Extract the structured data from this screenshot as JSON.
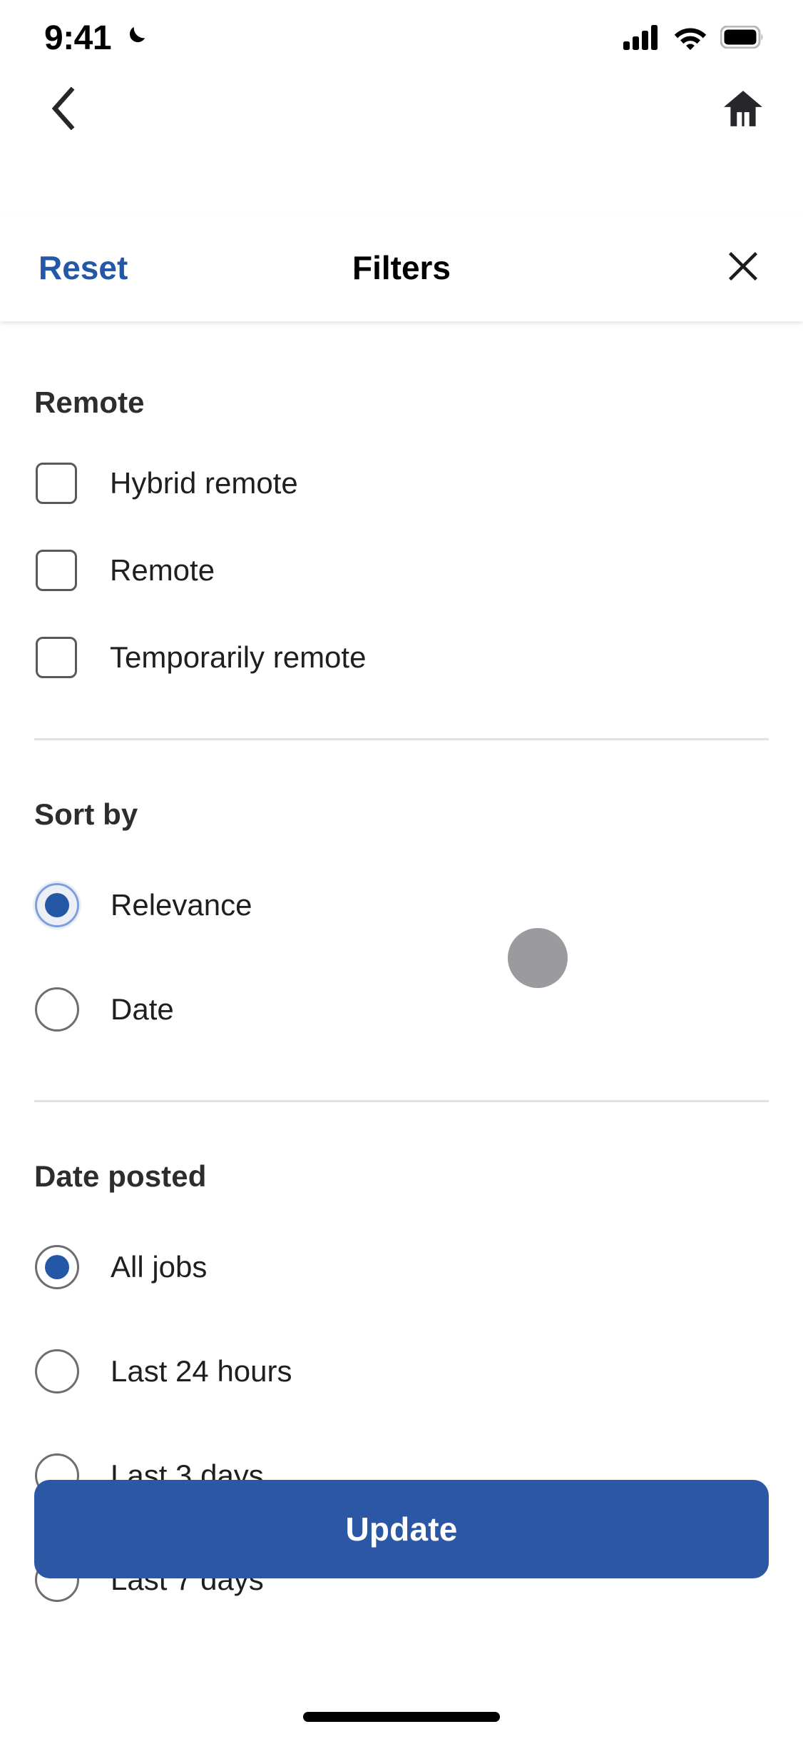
{
  "status_bar": {
    "time": "9:41",
    "dnd_icon": "moon-icon",
    "signal_icon": "cellular-signal-icon",
    "wifi_icon": "wifi-icon",
    "battery_icon": "battery-full-icon"
  },
  "nav_bar": {
    "back_icon": "back-chevron-icon",
    "home_icon": "home-icon"
  },
  "header": {
    "reset_label": "Reset",
    "title": "Filters",
    "close_icon": "close-x-icon"
  },
  "sections": [
    {
      "id": "remote",
      "title": "Remote",
      "control": "checkbox",
      "options": [
        {
          "label": "Hybrid remote",
          "checked": false
        },
        {
          "label": "Remote",
          "checked": false
        },
        {
          "label": "Temporarily remote",
          "checked": false
        }
      ]
    },
    {
      "id": "sort_by",
      "title": "Sort by",
      "control": "radio",
      "options": [
        {
          "label": "Relevance",
          "selected": true,
          "focused": true
        },
        {
          "label": "Date",
          "selected": false,
          "focused": false
        }
      ]
    },
    {
      "id": "date_posted",
      "title": "Date posted",
      "control": "radio",
      "options": [
        {
          "label": "All jobs",
          "selected": true,
          "focused": false
        },
        {
          "label": "Last 24 hours",
          "selected": false,
          "focused": false
        },
        {
          "label": "Last 3 days",
          "selected": false,
          "focused": false
        },
        {
          "label": "Last 7 days",
          "selected": false,
          "focused": false
        }
      ]
    }
  ],
  "footer": {
    "update_label": "Update"
  },
  "colors": {
    "accent_blue": "#2557a7",
    "button_blue": "#2b57a5",
    "text_dark": "#1f1f1f",
    "heading_dark": "#2d2d2d",
    "border_gray": "#6e6e6e",
    "divider_gray": "#e4e2e0",
    "touch_indicator_gray": "#9b9b9f"
  },
  "touch_indicator": {
    "present": true
  }
}
